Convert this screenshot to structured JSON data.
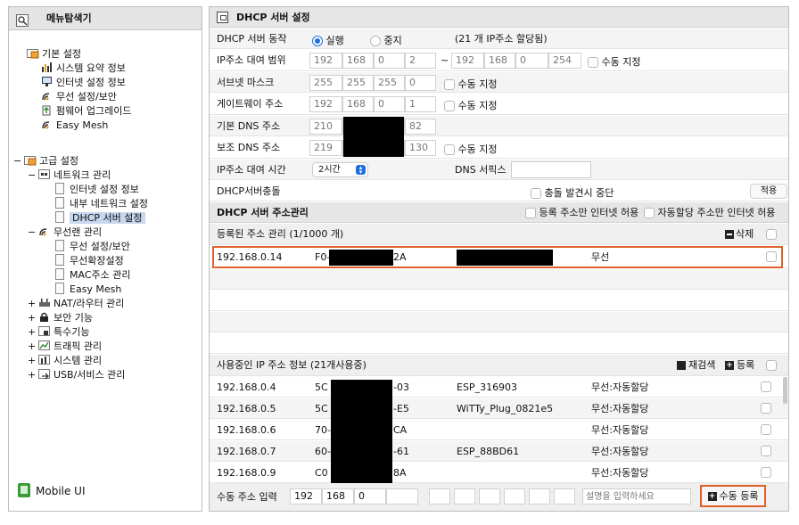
{
  "sidebar": {
    "title": "메뉴탐색기",
    "basic": {
      "label": "기본 설정",
      "items": [
        "시스템 요약 정보",
        "인터넷 설정 정보",
        "무선 설정/보안",
        "펌웨어 업그레이드",
        "Easy Mesh"
      ]
    },
    "advanced": {
      "label": "고급 설정",
      "network": {
        "label": "네트워크 관리",
        "items": [
          "인터넷 설정 정보",
          "내부 네트워크 설정",
          "DHCP 서버 설정"
        ]
      },
      "wireless": {
        "label": "무선랜 관리",
        "items": [
          "무선 설정/보안",
          "무선확장설정",
          "MAC주소 관리",
          "Easy Mesh"
        ]
      },
      "collapsed": [
        "NAT/라우터 관리",
        "보안 기능",
        "특수기능",
        "트래픽 관리",
        "시스템 관리",
        "USB/서비스 관리"
      ]
    },
    "mobile_ui": "Mobile UI"
  },
  "dhcp": {
    "title": "DHCP 서버 설정",
    "operation": {
      "label": "DHCP 서버 동작",
      "on": "실행",
      "off": "중지",
      "note": "(21 개 IP주소 할당됨)"
    },
    "range": {
      "label": "IP주소 대여 범위",
      "start": [
        "192",
        "168",
        "0",
        "2"
      ],
      "sep": "~",
      "end": [
        "192",
        "168",
        "0",
        "254"
      ],
      "manual": "수동 지정"
    },
    "subnet": {
      "label": "서브넷 마스크",
      "value": [
        "255",
        "255",
        "255",
        "0"
      ],
      "manual": "수동 지정"
    },
    "gateway": {
      "label": "게이트웨이 주소",
      "value": [
        "192",
        "168",
        "0",
        "1"
      ],
      "manual": "수동 지정"
    },
    "dns1": {
      "label": "기본 DNS 주소",
      "first": "210",
      "last": "82"
    },
    "dns2": {
      "label": "보조 DNS 주소",
      "first": "219",
      "last": "130",
      "manual": "수동 지정"
    },
    "lease": {
      "label": "IP주소 대여 시간",
      "value": "2시간",
      "suffix_label": "DNS 서픽스",
      "suffix_value": ""
    },
    "conflict": {
      "label": "DHCP서버충돌",
      "stop_label": "충돌 발견시 중단",
      "apply": "적용"
    }
  },
  "address_mgmt": {
    "title": "DHCP 서버 주소관리",
    "opt1": "등록 주소만 인터넷 허용",
    "opt2": "자동할당 주소만 인터넷 허용",
    "registered": {
      "title": "등록된 주소 관리 (1/1000 개)",
      "delete": "삭제",
      "rows": [
        {
          "ip": "192.168.0.14",
          "mac_start": "F0-",
          "mac_end": "2A",
          "type": "무선"
        }
      ]
    },
    "in_use": {
      "title": "사용중인 IP 주소 정보 (21개사용중)",
      "rescan": "재검색",
      "register": "등록",
      "rows": [
        {
          "ip": "192.168.0.4",
          "mac_start": "5C",
          "mac_end": "-03",
          "name": "ESP_316903",
          "type": "무선:자동할당"
        },
        {
          "ip": "192.168.0.5",
          "mac_start": "5C",
          "mac_end": "-E5",
          "name": "WiTTy_Plug_0821e5",
          "type": "무선:자동할당"
        },
        {
          "ip": "192.168.0.6",
          "mac_start": "70-",
          "mac_end": "CA",
          "name": "",
          "type": "무선:자동할당"
        },
        {
          "ip": "192.168.0.7",
          "mac_start": "60-",
          "mac_end": "-61",
          "name": "ESP_88BD61",
          "type": "무선:자동할당"
        },
        {
          "ip": "192.168.0.9",
          "mac_start": "C0",
          "mac_end": "8A",
          "name": "",
          "type": "무선:자동할당"
        }
      ]
    },
    "manual_input": {
      "label": "수동 주소 입력",
      "ip": [
        "192",
        "168",
        "0",
        ""
      ],
      "desc_placeholder": "설명을 입력하세요",
      "register": "수동 등록"
    }
  }
}
